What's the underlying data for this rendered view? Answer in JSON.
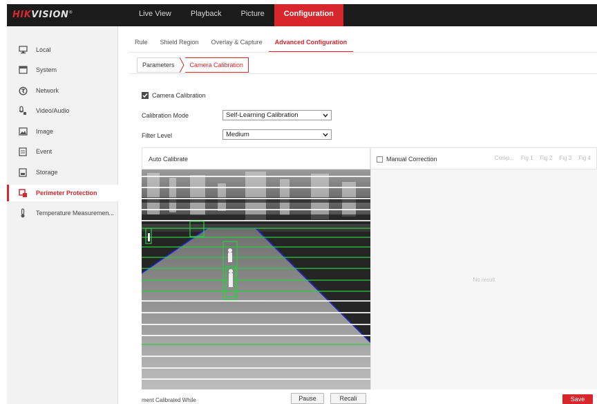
{
  "brand": {
    "hik": "HIK",
    "vision": "VISION",
    "reg": "®"
  },
  "topnav": [
    {
      "label": "Live View"
    },
    {
      "label": "Playback"
    },
    {
      "label": "Picture"
    },
    {
      "label": "Configuration"
    }
  ],
  "sidebar": {
    "items": [
      {
        "label": "Local",
        "icon": "monitor-icon"
      },
      {
        "label": "System",
        "icon": "system-icon"
      },
      {
        "label": "Network",
        "icon": "network-icon"
      },
      {
        "label": "Video/Audio",
        "icon": "video-audio-icon"
      },
      {
        "label": "Image",
        "icon": "image-icon"
      },
      {
        "label": "Event",
        "icon": "event-icon"
      },
      {
        "label": "Storage",
        "icon": "storage-icon"
      },
      {
        "label": "Perimeter Protection",
        "icon": "perimeter-icon"
      },
      {
        "label": "Temperature Measuremen...",
        "icon": "thermometer-icon"
      }
    ],
    "active_index": 7
  },
  "tabs": [
    {
      "label": "Rule"
    },
    {
      "label": "Shield Region"
    },
    {
      "label": "Overlay & Capture"
    },
    {
      "label": "Advanced Configuration"
    }
  ],
  "breadcrumb": {
    "parameters": "Parameters",
    "current": "Camera Calibration"
  },
  "form": {
    "camera_calibration_label": "Camera Calibration",
    "camera_calibration_checked": true,
    "calibration_mode_label": "Calibration Mode",
    "calibration_mode_value": "Self-Learning Calibration",
    "filter_level_label": "Filter Level",
    "filter_level_value": "Medium"
  },
  "left_panel": {
    "title": "Auto Calibrate"
  },
  "right_panel": {
    "manual_correction_label": "Manual Correction",
    "fig_tabs": [
      "Comp...",
      "Fig 1",
      "Fig 2",
      "Fig 3",
      "Fig 4"
    ],
    "no_result": "No result"
  },
  "bottom": {
    "status_text": "ment Calibrated While",
    "pause_label": "Pause",
    "recalibrate_label": "Recali",
    "save_label": "Save"
  },
  "colors": {
    "accent": "#d7262c",
    "calib_line": "#2ecc40",
    "road_outline": "#1a2ad6"
  }
}
